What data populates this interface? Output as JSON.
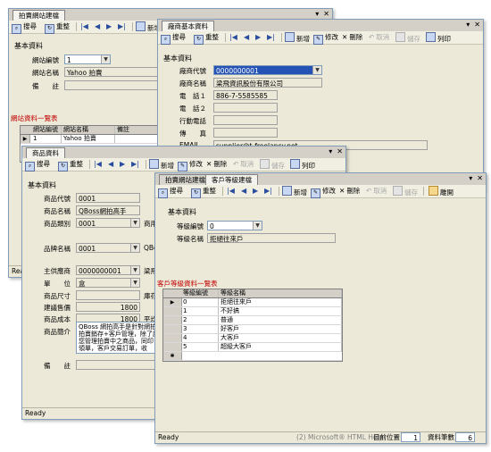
{
  "toolbar_common": {
    "search": "搜尋",
    "reload": "重整",
    "first": "|◀",
    "prev": "◀",
    "next": "▶",
    "last": "▶|",
    "new": "新增",
    "edit": "修改",
    "delete": "刪除",
    "undo": "取消",
    "save": "儲存",
    "print": "列印",
    "exit": "離開"
  },
  "site_window": {
    "tab": "拍賣網站建檔",
    "section": "基本資料",
    "fields": {
      "code_label": "網站編號",
      "code_value": "1",
      "name_label": "網站名稱",
      "name_value": "Yahoo 拍賣",
      "note_label": "備　　註"
    },
    "grid_title": "網站資料一覽表",
    "grid_cols": [
      "網站編號",
      "網站名稱",
      "備註"
    ],
    "grid_rows": [
      [
        "1",
        "Yahoo 拍賣",
        ""
      ]
    ],
    "status": "Rea"
  },
  "vendor_window": {
    "tab": "廠商基本資料",
    "section": "基本資料",
    "fields": {
      "id_label": "廠商代號",
      "id_value": "0000000001",
      "name_label": "廠商名稱",
      "name_value": "梁飛資訊股份有限公司",
      "tel1_label": "電　話１",
      "tel1_value": "886-7-5585585",
      "tel2_label": "電　話２",
      "mobile_label": "行動電話",
      "fax_label": "傳　　真",
      "email_label": "EMAIL",
      "email_value": "supplier@t-freelancy.net"
    }
  },
  "product_window": {
    "tab": "商品資料",
    "section": "基本資料",
    "fields": {
      "code_label": "商品代號",
      "code_value": "0001",
      "name_label": "商品名稱",
      "name_value": "QBoss網拍高手",
      "cat_label": "商品類別",
      "cat_value": "0001",
      "brand_label": "品牌名稱",
      "brand_value": "0001",
      "supplier_label": "主供應商",
      "supplier_value": "0000000001",
      "unit_label": "單　　位",
      "unit_value": "盒",
      "size_label": "商品尺寸",
      "price_label": "建議售價",
      "price_value": "1800",
      "cost_label": "商品成本",
      "cost_value": "1800",
      "intro_label": "商品簡介",
      "intro_value": "QBoss 網拍高手是針對網拍拍賣銷存+客戶管理，除了讓您管理拍賣中之商品，同印領單，客戶交易訂單，收",
      "note_label": "備　　註",
      "right_cut1": "商用",
      "right_cut2": "QBo",
      "right_cut3": "梁飛",
      "right_cut4": "庫存",
      "right_cut5": "平均"
    },
    "status": "Ready"
  },
  "customer_window": {
    "tabs": [
      "拍賣網站建檔",
      "客戶等級建檔"
    ],
    "section": "基本資料",
    "fields": {
      "level_code_label": "等級編號",
      "level_code_value": "0",
      "level_name_label": "等級名稱",
      "level_name_value": "拒絕往來戶"
    },
    "grid_title": "客戶等級資料一覽表",
    "grid_cols": [
      "等級編號",
      "等級名稱"
    ],
    "grid_rows": [
      [
        "0",
        "拒絕往來戶"
      ],
      [
        "1",
        "不好搞"
      ],
      [
        "2",
        "普通"
      ],
      [
        "3",
        "好客戶"
      ],
      [
        "4",
        "大客戶"
      ],
      [
        "5",
        "超級大客戶"
      ]
    ],
    "status": "Ready",
    "status_mid": "(2) Microsoft® HTML Help",
    "pos_label": "目前位置",
    "pos_value": "1",
    "count_label": "資料筆數",
    "count_value": "6"
  }
}
